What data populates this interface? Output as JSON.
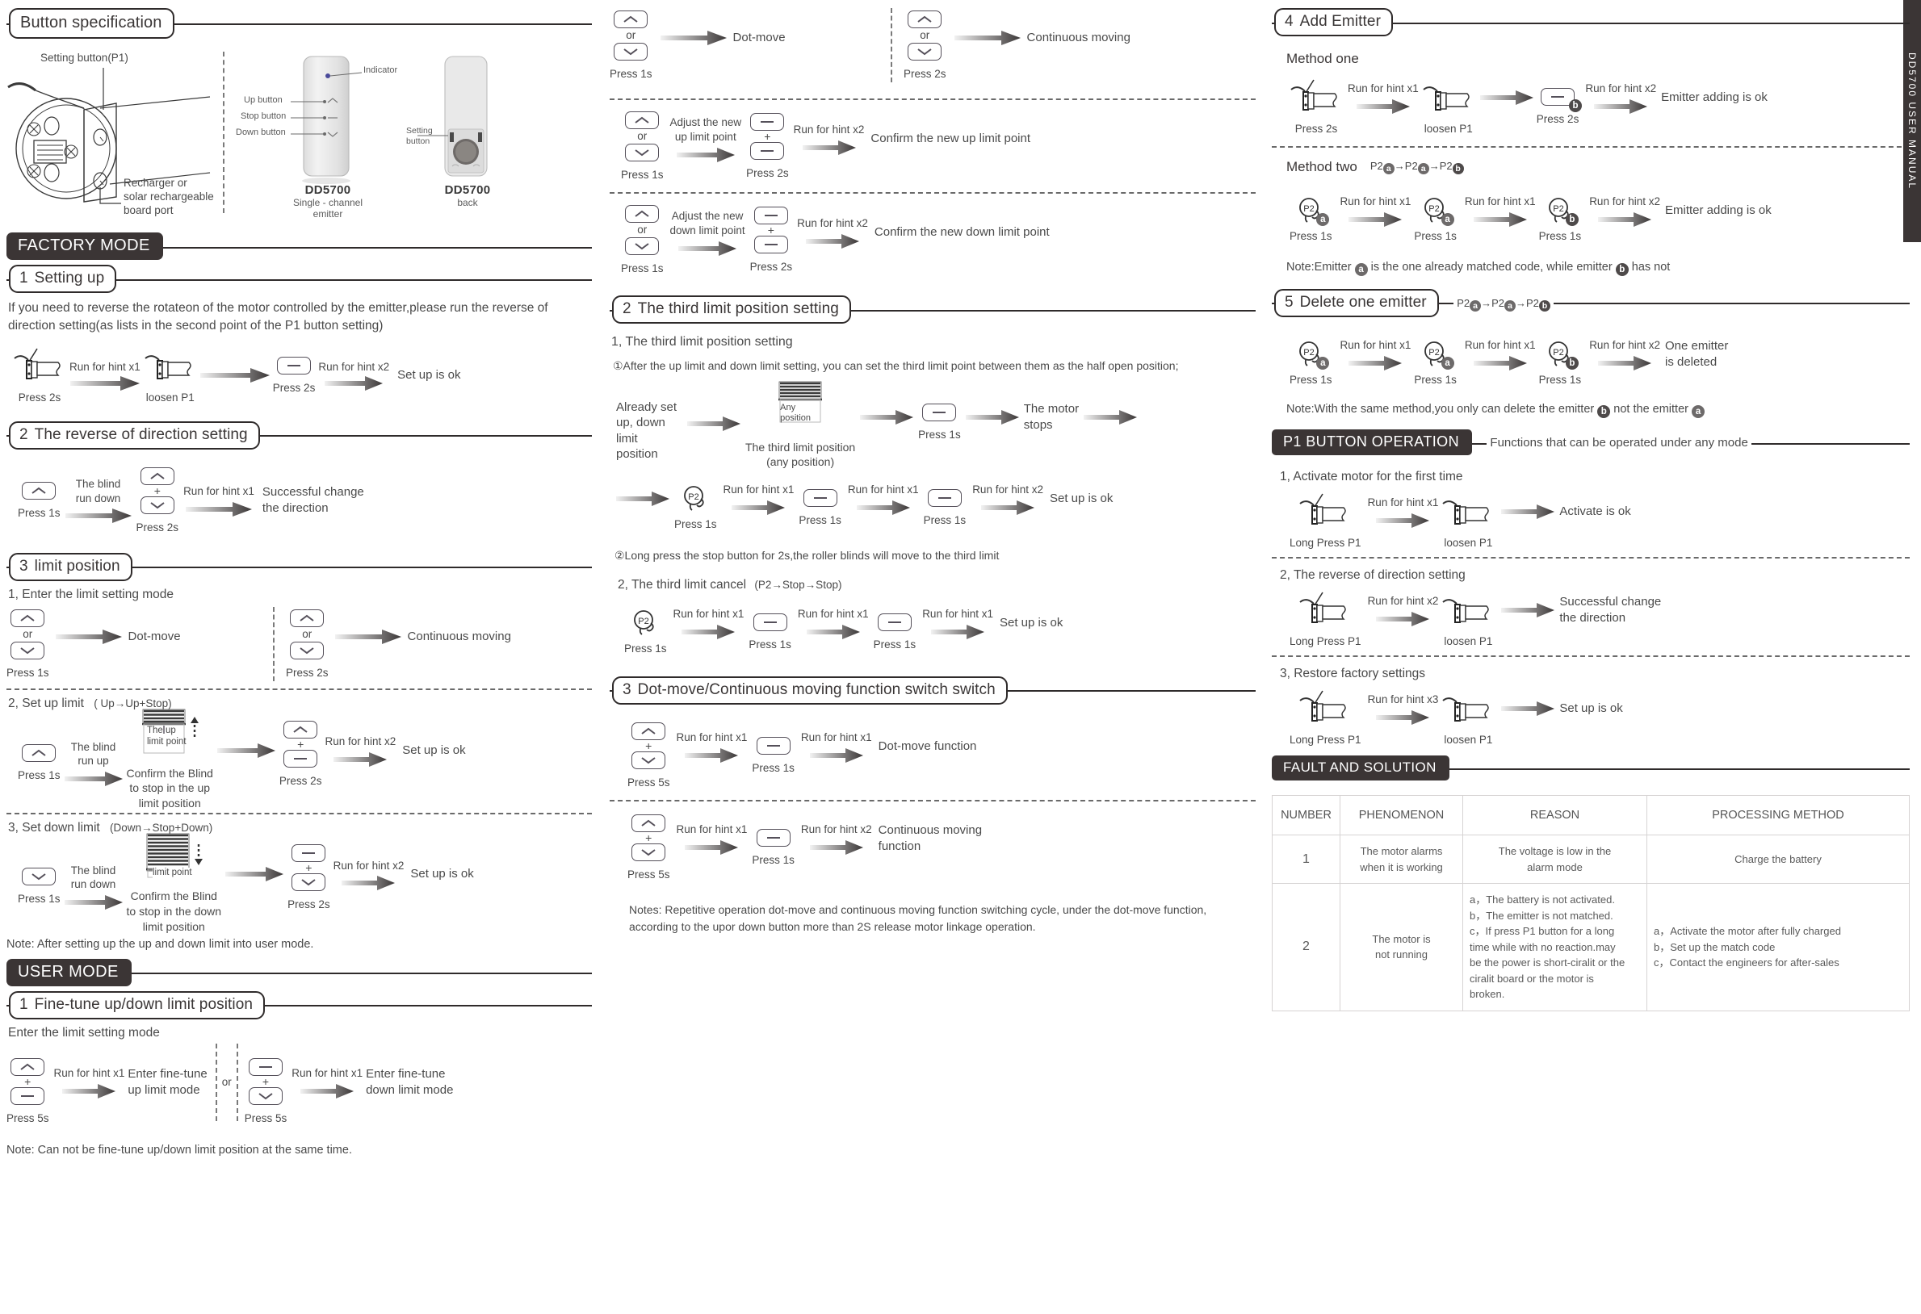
{
  "common": {
    "press_1s": "Press 1s",
    "press_2s": "Press 2s",
    "press_5s": "Press 5s",
    "loosen_p1": "loosen P1",
    "long_press_p1": "Long Press P1",
    "run_hint_x1": "Run for hint x1",
    "run_hint_x2": "Run for hint x2",
    "run_hint_x3": "Run for hint x3",
    "setup_ok": "Set up is ok",
    "or": "or",
    "plus": "+",
    "p2": "P2",
    "badge_a": "a",
    "badge_b": "b"
  },
  "left": {
    "title": "Button specification",
    "motor_diagram": {
      "setting_button_label": "Setting button(P1)",
      "recharger_label": "Recharger or\nsolar rechargeable\nboard port"
    },
    "emitter_front": {
      "indicator": "Indicator",
      "up_button": "Up  button",
      "stop_button": "Stop  button",
      "down_button": "Down  button",
      "model": "DD5700",
      "sub": "Single - channel  emitter"
    },
    "emitter_back": {
      "setting_button": "Setting\nbutton",
      "model": "DD5700",
      "sub": "back"
    },
    "factory_mode": "FACTORY MODE",
    "s1": {
      "heading_num": "1",
      "heading": "Setting up",
      "body": "If you need to reverse the rotateon of the motor controlled by the emitter,please run the reverse of direction setting(as lists in the second point of the P1 button setting)",
      "steps": [
        "Press 2s",
        "loosen P1",
        "Press 2s"
      ],
      "arrow1": "Run for hint x1",
      "arrow3": "Run for hint x2",
      "result": "Set up is ok"
    },
    "s2": {
      "heading_num": "2",
      "heading": "The reverse of direction setting",
      "arrow1": "The blind\nrun down",
      "arrow2": "Run for hint x1",
      "cap1": "Press 1s",
      "cap2": "Press 2s",
      "result": "Successful change\nthe direction"
    },
    "s3": {
      "heading_num": "3",
      "heading": "limit position",
      "p1_title": "1, Enter the limit setting mode",
      "dotmove": "Dot-move",
      "continuous": "Continuous moving",
      "cap_left": "Press 1s",
      "cap_right": "Press 2s",
      "p2_title": "2, Set up limit",
      "p2_paren": "( Up→Up+Stop)",
      "p2_arrow1": "The blind\nrun up",
      "p2_blind_label": "The up\nlimit point",
      "p2_confirm": "Confirm the Blind\nto stop in the up\nlimit position",
      "p2_arrow3": "Run for hint x2",
      "p2_cap1": "Press 1s",
      "p2_cap2": "Press 2s",
      "p2_result": "Set up is ok",
      "p3_title": "3, Set down limit",
      "p3_paren": "(Down→Stop+Down)",
      "p3_arrow1": "The blind\nrun down",
      "p3_blind_label": "limit point",
      "p3_confirm": "Confirm the Blind\nto stop in the down\nlimit position",
      "p3_arrow3": "Run for hint x2",
      "p3_cap1": "Press 1s",
      "p3_cap2": "Press 2s",
      "p3_result": "Set up is ok",
      "note": "Note: After setting up the up  and down limit into user mode."
    },
    "user_mode": "USER MODE",
    "u1": {
      "heading_num": "1",
      "heading": "Fine-tune up/down limit position",
      "subtitle": "Enter the limit setting mode",
      "left_arrow": "Run for hint x1",
      "left_result": "Enter fine-tune\nup limit mode",
      "left_cap": "Press 5s",
      "or": "or",
      "right_arrow": "Run for hint x1",
      "right_result": "Enter fine-tune\ndown limit mode",
      "right_cap": "Press 5s",
      "note": "Note: Can not be fine-tune up/down limit position at the same time."
    }
  },
  "mid": {
    "top_left": {
      "dotmove": "Dot-move",
      "cap": "Press 1s"
    },
    "top_right": {
      "continuous": "Continuous moving",
      "cap": "Press 2s"
    },
    "up_limit": {
      "arrow1": "Adjust the new\nup limit point",
      "arrow2": "Run for hint x2",
      "result": "Confirm the new up limit point",
      "cap1": "Press 1s",
      "cap2": "Press 2s"
    },
    "down_limit": {
      "arrow1": "Adjust the new\ndown limit point",
      "arrow2": "Run for hint x2",
      "result": "Confirm the new down limit point",
      "cap1": "Press 1s",
      "cap2": "Press 2s"
    },
    "s2": {
      "heading_num": "2",
      "heading": "The third limit position setting",
      "p1_title": "1, The third limit position setting",
      "p1_note": "①After the up limit and down limit setting, you can set the third limit point between them as the half open position;",
      "flow_a": {
        "start": "Already set\nup, down\nlimit position",
        "blind_label": "Any\nposition",
        "blind_cap": "The third limit position\n(any position)",
        "cap_stop": "Press 1s",
        "result": "The motor\nstops"
      },
      "flow_b": {
        "a1": "Run for hint x1",
        "a2": "Run for hint x1",
        "a3": "Run for hint x2",
        "cap1": "Press 1s",
        "cap2": "Press 1s",
        "cap3": "Press 1s",
        "result": "Set up is ok"
      },
      "p2_note": "②Long press the stop button for 2s,the roller blinds will move to the third limit",
      "p2_title": "2, The third limit cancel",
      "p2_paren": "(P2→Stop→Stop)",
      "flow_c": {
        "a1": "Run for hint x1",
        "a2": "Run for hint x1",
        "a3": "Run for hint x1",
        "cap1": "Press 1s",
        "cap2": "Press 1s",
        "cap3": "Press 1s",
        "result": "Set up is ok"
      }
    },
    "s3": {
      "heading_num": "3",
      "heading": "Dot-move/Continuous moving function switch switch",
      "flow1": {
        "a1": "Run for hint x1",
        "a2": "Run for hint x1",
        "cap1": "Press 5s",
        "cap2": "Press 1s",
        "result": "Dot-move function"
      },
      "flow2": {
        "a1": "Run for hint x1",
        "a2": "Run for hint x2",
        "cap1": "Press 5s",
        "cap2": "Press 1s",
        "result": "Continuous moving\nfunction"
      },
      "notes": "Notes: Repetitive operation dot-move and continuous moving function switching cycle, under the dot-move  function, according to the upor down button more than 2S release motor linkage operation."
    }
  },
  "right": {
    "s4": {
      "heading_num": "4",
      "heading": "Add Emitter",
      "method_one": "Method  one",
      "m1_a1": "Run for hint x1",
      "m1_a2": "Run for hint x2",
      "m1_cap1": "Press 2s",
      "m1_cap2": "loosen P1",
      "m1_cap3": "Press 2s",
      "m1_result": "Emitter adding  is ok",
      "method_two": "Method  two",
      "m2_seq_p2": "P2",
      "m2_a1": "Run for hint x1",
      "m2_a2": "Run for hint x1",
      "m2_a3": "Run for hint x2",
      "m2_cap1": "Press 1s",
      "m2_cap2": "Press 1s",
      "m2_cap3": "Press 1s",
      "m2_result": "Emitter adding  is ok",
      "note_pre": "Note:Emitter",
      "note_mid": "is the one already matched code, while emitter",
      "note_post": "has not"
    },
    "s5": {
      "heading_num": "5",
      "heading": "Delete one emitter",
      "a1": "Run for hint x1",
      "a2": "Run for hint x1",
      "a3": "Run for hint x2",
      "cap1": "Press 1s",
      "cap2": "Press 1s",
      "cap3": "Press 1s",
      "result": "One emitter\nis deleted",
      "note_pre": "Note:With the same method,you only can delete the emitter",
      "note_mid": "not the emitter"
    },
    "p1_op": {
      "title": "P1 BUTTON OPERATION",
      "subtitle": "Functions that can be operated under any mode",
      "i1": {
        "title": "1, Activate motor for the first time",
        "arrow": "Run for hint x1",
        "cap1": "Long Press P1",
        "cap2": "loosen P1",
        "result": "Activate is ok"
      },
      "i2": {
        "title": "2, The reverse of direction setting",
        "arrow": "Run for hint x2",
        "cap1": "Long Press P1",
        "cap2": "loosen P1",
        "result": "Successful change\nthe direction"
      },
      "i3": {
        "title": "3, Restore factory settings",
        "arrow": "Run for hint x3",
        "cap1": "Long Press P1",
        "cap2": "loosen P1",
        "result": "Set up is ok"
      }
    },
    "fault": {
      "title": "FAULT AND SOLUTION",
      "headers": [
        "NUMBER",
        "PHENOMENON",
        "REASON",
        "PROCESSING METHOD"
      ],
      "rows": [
        {
          "number": "1",
          "phenomenon": "The motor alarms\nwhen it is working",
          "reason": "The voltage is low in the\nalarm mode",
          "method": "Charge the battery"
        },
        {
          "number": "2",
          "phenomenon": "The motor is\nnot running",
          "reason": "a，The battery is not activated.\nb，The emitter is not matched.\nc，If press P1 button for a long\ntime while with no reaction.may\nbe the power is short-ciralit or the\nciralit board or the motor is\nbroken.",
          "method": "a，Activate the motor after fully charged\nb，Set up the match code\nc，Contact the engineers for after-sales"
        }
      ]
    }
  },
  "edge_strip": "DD5700 USER MANUAL"
}
